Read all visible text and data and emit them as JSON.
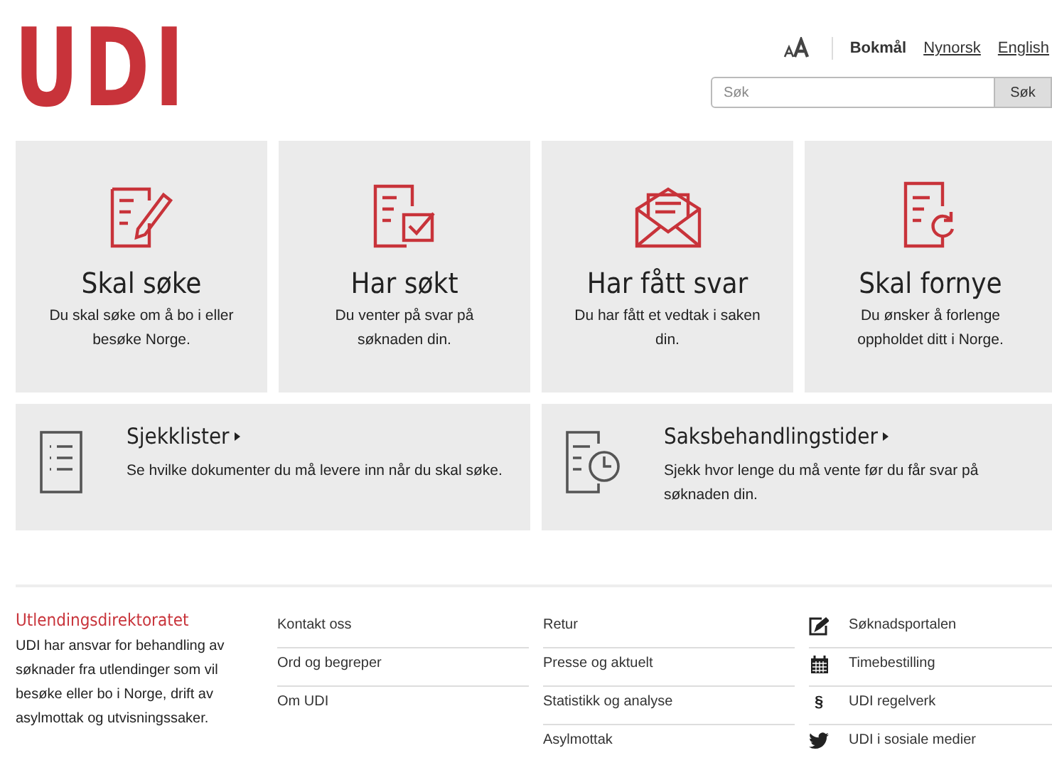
{
  "logo": "UDI",
  "languages": [
    {
      "label": "Bokmål",
      "selected": true
    },
    {
      "label": "Nynorsk",
      "selected": false
    },
    {
      "label": "English",
      "selected": false
    }
  ],
  "search": {
    "placeholder": "Søk",
    "button": "Søk"
  },
  "tiles": [
    {
      "kind": "apply",
      "title": "Skal søke",
      "text": "Du skal søke om å bo i eller besøke Norge."
    },
    {
      "kind": "applied",
      "title": "Har søkt",
      "text": "Du venter på svar på søknaden din."
    },
    {
      "kind": "answer",
      "title": "Har fått svar",
      "text": "Du har fått et vedtak i saken din."
    },
    {
      "kind": "renew",
      "title": "Skal fornye",
      "text": "Du ønsker å forlenge oppholdet ditt i Norge."
    }
  ],
  "wide_tiles": [
    {
      "kind": "list",
      "title": "Sjekklister",
      "text": "Se hvilke dokumenter du må levere inn når du skal søke."
    },
    {
      "kind": "clock",
      "title": "Saksbehandlingstider",
      "text": "Sjekk hvor lenge du må vente før du får svar på søknaden din."
    }
  ],
  "footer": {
    "title": "Utlendingsdirektoratet",
    "text": "UDI har ansvar for behandling av søknader fra utlendinger som vil besøke eller bo i Norge, drift av asylmottak og utvisningssaker.",
    "links_1": [
      "Kontakt oss",
      "Ord og begreper",
      "Om UDI"
    ],
    "links_2": [
      "Retur",
      "Presse og aktuelt",
      "Statistikk og analyse",
      "Asylmottak"
    ],
    "services": [
      {
        "kind": "edit",
        "label": "Søknadsportalen"
      },
      {
        "kind": "calendar",
        "label": "Timebestilling"
      },
      {
        "kind": "paragraph",
        "icon": "§",
        "label": "UDI regelverk"
      },
      {
        "kind": "bird",
        "label": "UDI i sosiale medier"
      }
    ]
  }
}
